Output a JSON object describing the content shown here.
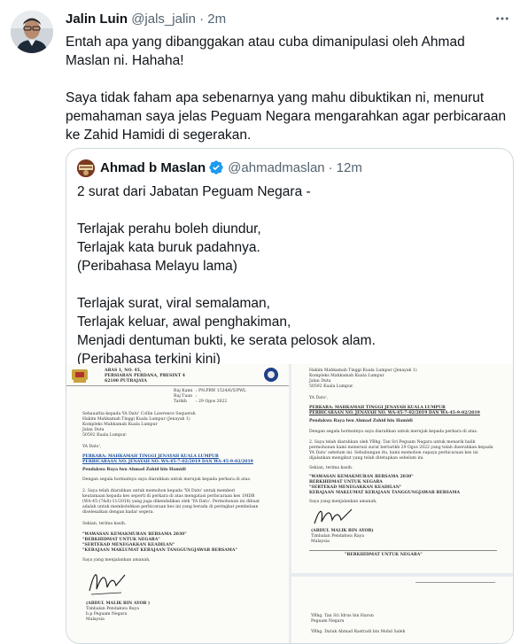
{
  "tweet": {
    "author_name": "Jalin Luin",
    "author_handle": "@jals_jalin",
    "separator": "·",
    "time": "2m",
    "paragraphs": [
      "Entah apa yang dibanggakan atau cuba dimanipulasi oleh Ahmad Maslan ni. Hahaha!",
      "Saya tidak faham apa sebenarnya yang mahu dibuktikan ni, menurut pemahaman saya jelas Peguam Negara mengarahkan agar perbicaraan ke Zahid Hamidi di segerakan."
    ]
  },
  "quoted_tweet": {
    "author_name": "Ahmad b Maslan",
    "author_handle": "@ahmadmaslan",
    "separator": "·",
    "time": "12m",
    "paragraphs": [
      [
        "2 surat dari Jabatan Peguam Negara -"
      ],
      [
        "Terlajak perahu boleh diundur,",
        "Terlajak kata buruk padahnya.",
        "(Peribahasa Melayu lama)"
      ],
      [
        "Terlajak surat, viral semalaman,",
        "Terlajak keluar, awal penghakiman,",
        "Menjadi dentuman bukti, ke serata pelosok alam.",
        "(Peribahasa terkini kini)"
      ]
    ]
  },
  "documents": {
    "letter1": {
      "address": [
        "ARAS 1, NO. 45,",
        "PERSIARAN PERDANA, PRESINT 4",
        "62100 PUTRAJAYA"
      ],
      "ref_labels": [
        "Ruj Kami",
        "Ruj Tuan",
        "Tarikh"
      ],
      "ref_values": [
        ": PN.PRW 1524/6/5/PWL",
        ":",
        ": 29 Ogos 2022"
      ],
      "recipient": [
        "Sebaualtia-kepada YA Dato' Collin Lawrence Sequerah",
        "Hakim Mahkamah Tinggi Kuala Lumpur (Jenayah 1)",
        "Kompleks Mahkamah Kuala Lumpur",
        "Jalan Duta",
        "50592 Kuala Lumpur."
      ],
      "salutation": "YA Dato',",
      "subject": [
        "PERKARA: MAHKAMAH TINGGI JENAYAH KUALA LUMPUR",
        "PERBICARAAN NO. JENAYAH NO. WA-45-7-02/2019 DAN WA-45-9-02/2019"
      ],
      "case_line": "Pendakwa Raya lwn Ahmad Zahid bin Hamidi",
      "para1": "Dengan segala hormatnya saya diarahkan untuk merujuk kepada perkara di atas.",
      "para2": [
        "2.    Saya telah diarahkan untuk memohon kepada 'YA Dato' untuk memberi",
        "keutamaan kepada kes seperti di perkara di atas mengatasi perbicaraan kes 1MDB",
        "(WA-45-(7&8)-11/2018) yang juga dikendalikan oleh 'YA Dato'. Permohonan ini dibuat",
        "adalah untuk membolehkan perbicaraan kes ini yang berada di peringkat pembelaan",
        "diselesaikan dengan kadar segera."
      ],
      "thanks": "Sekian, terima kasih.",
      "slogans": [
        "\"WAWASAN KEMAKMURAN BERSAMA 2030\"",
        "\"BERKHIDMAT UNTUK NEGARA\"",
        "\"SERTEKAD MENEGAKKAN KEADILAN\"",
        "\"KERAJAAN MAKLUMAT KERAJAAN TANGGUNGJAWAB BERSAMA\""
      ],
      "closing": "Saya yang menjalankan amanah,",
      "signatory": [
        "(ABDUL MALIK BIN AYOB )",
        "Timbalan Pendakwa Raya",
        "b.p Peguam Negara",
        "Malaysia"
      ]
    },
    "letter2": {
      "recipient": [
        "Hakim Mahkamah Tinggi Kuala Lumpur (Jenayah 1)",
        "Kompleks Mahkamah Kuala Lumpur",
        "Jalan Duta",
        "50592 Kuala Lumpur."
      ],
      "salutation": "YA Dato',",
      "subject": [
        "PERKARA: MAHKAMAH TINGGI JENAYAH KUALA LUMPUR",
        "PERBICARAAN NO. JENAYAH NO. WA-45-7-02/2019 DAN WA-45-9-02/2019"
      ],
      "case_line": "Pendakwa Raya lwn Ahmad Zahid bin Hamidi",
      "para1": "Dengan segala hormatnya saya diarahkan untuk merujuk kepada perkara di atas.",
      "para2": [
        "2.    Saya telah diarahkan oleh YBhg. Tan Sri Peguam Negara untuk menarik balik",
        "permohonan kami menerusi surat bertarikh 29 Ogos 2022 yang telah diserahkan kepada",
        "YA Dato' sebelum ini. Sehubungan itu, kami memohon supaya perbicaraan kes ini",
        "dijalankan mengikut yang telah ditetapkan sebelum ini."
      ],
      "thanks": "Sekian, terima kasih.",
      "slogans": [
        "\"WAWASAN KEMAKMURAN BERSAMA 2030\"",
        "BERKHIDMAT UNTUK NEGARA",
        "\"SERTEKAD MENEGAKKAN KEADILAN\"",
        "KERAJAAN MAKLUMAT KERAJAAN TANGGUNGJAWAB BERSAMA"
      ],
      "closing": "Saya yang menjalankan amanah,",
      "signatory": [
        "(ABDUL MALIK BIN AYOB)",
        "Timbalan Pendakwa Raya",
        "Malaysia"
      ],
      "footer": "\"BERKHIDMAT UNTUK NEGARA\""
    },
    "letter3": {
      "lines": [
        "YBhg. Tan Sri Idrus bin Harun",
        "Peguam Negara",
        "YBhg. Datuk Ahmad Rastradi bin Mohd Saleh"
      ]
    }
  },
  "colors": {
    "text_primary": "#0f1419",
    "text_secondary": "#536471",
    "border": "#cfd9de",
    "verified_blue": "#1d9bf0",
    "doc_link_blue": "#1a4fa0"
  },
  "icons": [
    "more-options-icon",
    "verified-badge-icon",
    "avatar",
    "quoted-avatar",
    "jata-negara-crest-icon",
    "agc-logo-icon"
  ]
}
